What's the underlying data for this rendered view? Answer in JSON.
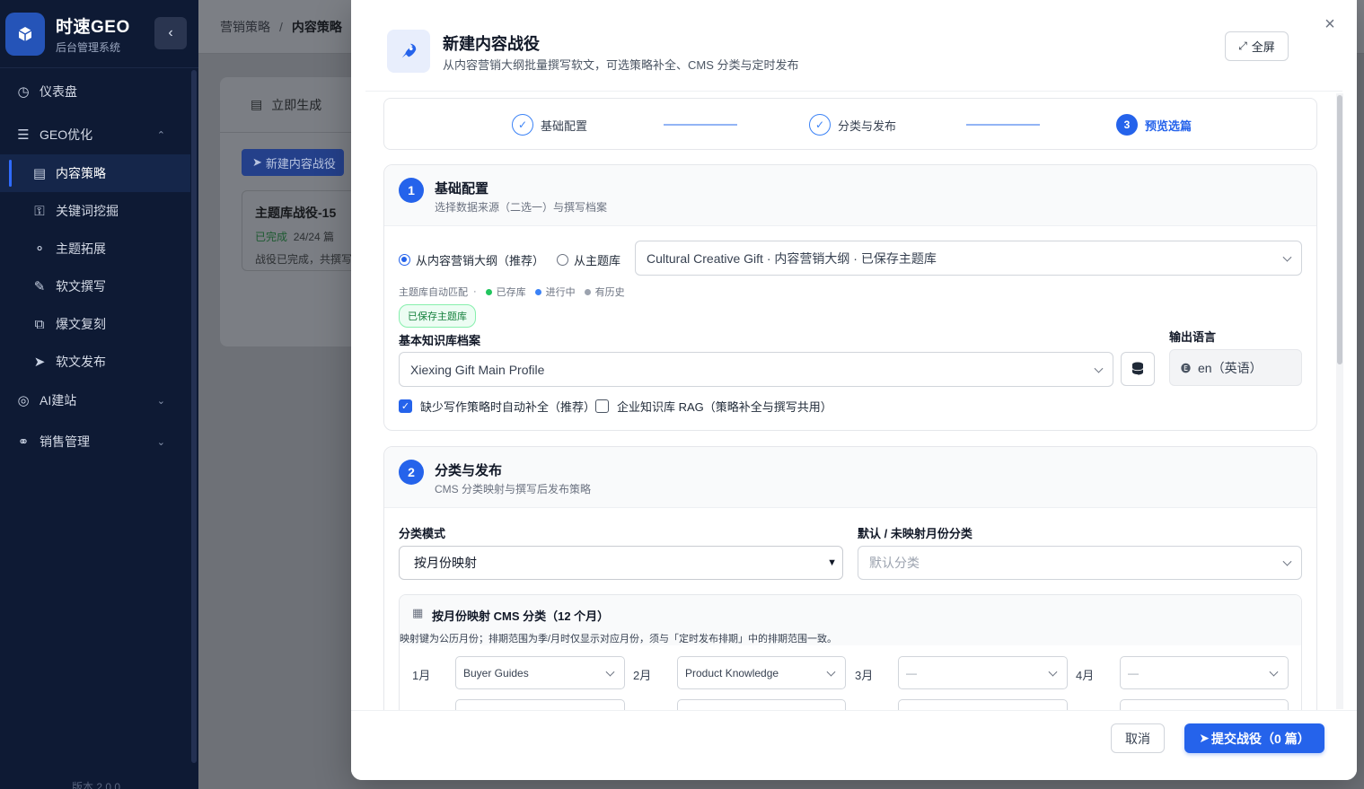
{
  "sidebar": {
    "brand_name": "时速GEO",
    "brand_sub": "后台管理系统",
    "version": "版本 2.0.0",
    "items": [
      {
        "label": "仪表盘"
      },
      {
        "label": "GEO优化"
      },
      {
        "label": "内容策略"
      },
      {
        "label": "关键词挖掘"
      },
      {
        "label": "主题拓展"
      },
      {
        "label": "软文撰写"
      },
      {
        "label": "爆文复刻"
      },
      {
        "label": "软文发布"
      },
      {
        "label": "AI建站"
      },
      {
        "label": "销售管理"
      }
    ]
  },
  "background": {
    "breadcrumb_parent": "营销策略",
    "breadcrumb_sep": "/",
    "breadcrumb_current": "内容策略",
    "tab_label": "立即生成",
    "new_button": "新建内容战役",
    "card_title": "主题库战役-15",
    "card_status": "已完成",
    "card_count": "24/24 篇",
    "card_desc": "战役已完成，共撰写"
  },
  "modal": {
    "title": "新建内容战役",
    "subtitle": "从内容营销大纲批量撰写软文，可选策略补全、CMS 分类与定时发布",
    "fullscreen_label": "全屏",
    "close_label": "×",
    "steps": [
      {
        "num": "1",
        "label": "基础配置"
      },
      {
        "num": "2",
        "label": "分类与发布"
      },
      {
        "num": "3",
        "label": "预览选篇"
      }
    ],
    "section1": {
      "num": "1",
      "title": "基础配置",
      "subtitle": "选择数据来源（二选一）与撰写档案",
      "radio_outline": "从内容营销大纲（推荐）",
      "radio_topic": "从主题库",
      "source_select": "Cultural Creative Gift · 内容营销大纲 · 已保存主题库",
      "legend_title": "主题库自动匹配",
      "legend_sep": "·",
      "legend_saved": "已存库",
      "legend_running": "进行中",
      "legend_history": "有历史",
      "saved_tag": "已保存主题库",
      "kb_label": "基本知识库档案",
      "kb_select": "Xiexing Gift Main Profile",
      "lang_label": "输出语言",
      "lang_value": "en（英语）",
      "check_auto": "缺少写作策略时自动补全（推荐）",
      "check_rag": "企业知识库 RAG（策略补全与撰写共用）"
    },
    "section2": {
      "num": "2",
      "title": "分类与发布",
      "subtitle": "CMS 分类映射与撰写后发布策略",
      "mode_label": "分类模式",
      "mode_value": "按月份映射",
      "default_label": "默认 / 未映射月份分类",
      "default_placeholder": "默认分类",
      "month_title": "按月份映射 CMS 分类（12 个月）",
      "month_desc": "映射键为公历月份；排期范围为季/月时仅显示对应月份，须与「定时发布排期」中的排期范围一致。",
      "months": [
        {
          "label": "1月",
          "value": "Buyer Guides"
        },
        {
          "label": "2月",
          "value": "Product Knowledge"
        },
        {
          "label": "3月",
          "value": "—"
        },
        {
          "label": "4月",
          "value": "—"
        }
      ]
    },
    "footer": {
      "cancel": "取消",
      "submit": "提交战役（0 篇）"
    }
  },
  "colors": {
    "primary": "#2563eb",
    "sidebar_bg": "#0e1a34",
    "success": "#22c55e"
  }
}
